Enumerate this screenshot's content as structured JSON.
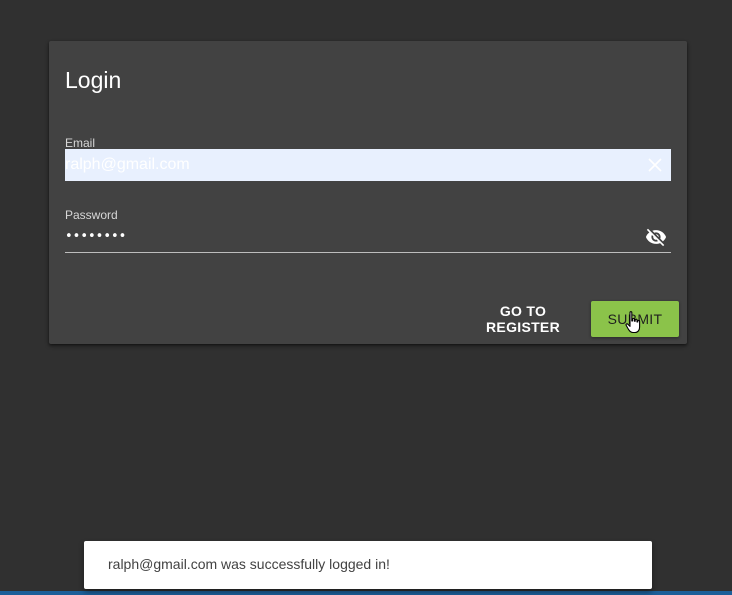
{
  "login": {
    "title": "Login",
    "email_label": "Email",
    "email_value": "ralph@gmail.com",
    "password_label": "Password",
    "password_value": "ralph123",
    "register_button": "GO TO REGISTER",
    "submit_button": "SUBMIT"
  },
  "snackbar": {
    "message": "ralph@gmail.com was successfully logged in!"
  },
  "icons": {
    "clear": "close-icon",
    "visibility": "visibility-off-icon",
    "cursor": "hand-pointer-icon"
  },
  "colors": {
    "background": "#303030",
    "card": "#424242",
    "accent": "#8bc34a",
    "autofill": "#e8f0fe"
  }
}
